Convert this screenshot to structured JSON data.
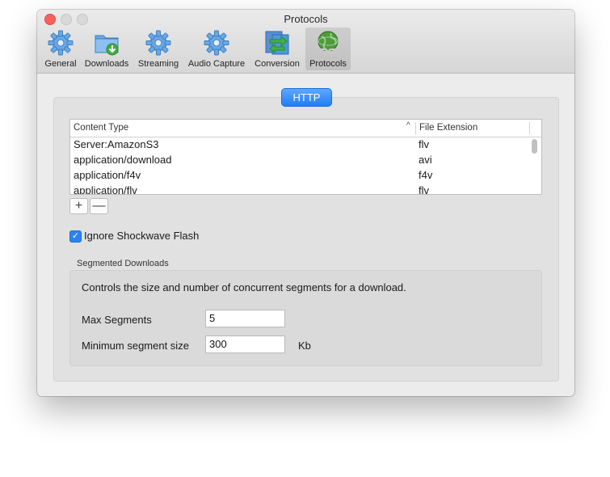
{
  "window": {
    "title": "Protocols"
  },
  "toolbar": {
    "items": [
      {
        "label": "General",
        "icon": "gear-icon"
      },
      {
        "label": "Downloads",
        "icon": "download-folder-icon"
      },
      {
        "label": "Streaming",
        "icon": "gear-icon"
      },
      {
        "label": "Audio Capture",
        "icon": "gear-icon"
      },
      {
        "label": "Conversion",
        "icon": "conversion-arrows-icon"
      },
      {
        "label": "Protocols",
        "icon": "globe-link-icon",
        "selected": true
      }
    ]
  },
  "tab": {
    "label": "HTTP"
  },
  "table": {
    "columns": [
      "Content Type",
      "File Extension"
    ],
    "sort_indicator": "^",
    "rows": [
      {
        "content_type": "Server:AmazonS3",
        "extension": "flv"
      },
      {
        "content_type": "application/download",
        "extension": "avi"
      },
      {
        "content_type": "application/f4v",
        "extension": "f4v"
      },
      {
        "content_type": "application/flv",
        "extension": "flv"
      }
    ]
  },
  "buttons": {
    "add": "+",
    "remove": "—"
  },
  "ignore_flash": {
    "label": "Ignore Shockwave Flash",
    "checked": true
  },
  "segmented": {
    "group_title": "Segmented Downloads",
    "description": "Controls the size and number of concurrent segments for a download.",
    "max_segments_label": "Max Segments",
    "max_segments_value": "5",
    "min_size_label": "Minimum segment size",
    "min_size_value": "300",
    "min_size_unit": "Kb"
  },
  "colors": {
    "accent": "#2b82f5",
    "close": "#fc605b"
  }
}
